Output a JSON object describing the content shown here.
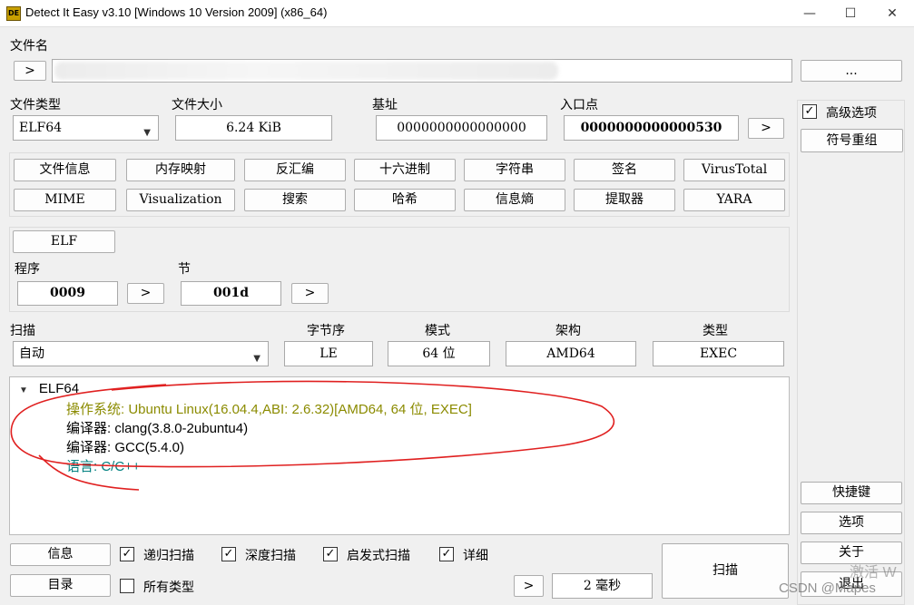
{
  "window": {
    "title": "Detect It Easy v3.10 [Windows 10 Version 2009] (x86_64)",
    "icon_text": "DE",
    "controls": {
      "minimize": "—",
      "maximize": "☐",
      "close": "✕"
    }
  },
  "file": {
    "label": "文件名",
    "open_arrow": ">",
    "path_value": "",
    "browse_label": "..."
  },
  "info": {
    "file_type_label": "文件类型",
    "file_type_value": "ELF64",
    "file_size_label": "文件大小",
    "file_size_value": "6.24 KiB",
    "base_label": "基址",
    "base_value": "0000000000000000",
    "entry_label": "入口点",
    "entry_value": "0000000000000530",
    "entry_arrow": ">"
  },
  "advanced": {
    "checkbox_label": "高级选项",
    "checked": true,
    "symbol_button": "符号重组"
  },
  "tools_row1": [
    "文件信息",
    "内存映射",
    "反汇编",
    "十六进制",
    "字符串",
    "签名",
    "VirusTotal"
  ],
  "tools_row2": [
    "MIME",
    "Visualization",
    "搜索",
    "哈希",
    "信息熵",
    "提取器",
    "YARA"
  ],
  "elf": {
    "button": "ELF",
    "program_label": "程序",
    "program_value": "0009",
    "section_label": "节",
    "section_value": "001d",
    "arrow": ">"
  },
  "scan": {
    "label": "扫描",
    "mode_value": "自动",
    "endian_label": "字节序",
    "endian_value": "LE",
    "mode_label": "模式",
    "bits_value": "64 位",
    "arch_label": "架构",
    "arch_value": "AMD64",
    "type_label": "类型",
    "type_value": "EXEC"
  },
  "results": {
    "root": "ELF64",
    "lines": [
      {
        "text": "操作系统: Ubuntu Linux(16.04.4,ABI: 2.6.32)[AMD64, 64 位, EXEC]",
        "color": "#8b8b00"
      },
      {
        "text": "编译器: clang(3.8.0-2ubuntu4)",
        "color": "#000000"
      },
      {
        "text": "编译器: GCC(5.4.0)",
        "color": "#000000"
      },
      {
        "text": "语言: C/C++",
        "color": "#008080"
      }
    ],
    "annotation_color": "#e02020"
  },
  "bottom": {
    "info_button": "信息",
    "dir_button": "目录",
    "recursive": "递归扫描",
    "deep": "深度扫描",
    "heuristic": "启发式扫描",
    "verbose": "详细",
    "all_types": "所有类型",
    "time_arrow": ">",
    "time_value": "2 毫秒",
    "scan_button": "扫描"
  },
  "side": {
    "shortcuts": "快捷键",
    "options": "选项",
    "about": "关于",
    "exit": "退出"
  },
  "watermark": {
    "activate": "激活 W",
    "csdn": "CSDN @Mapes"
  }
}
